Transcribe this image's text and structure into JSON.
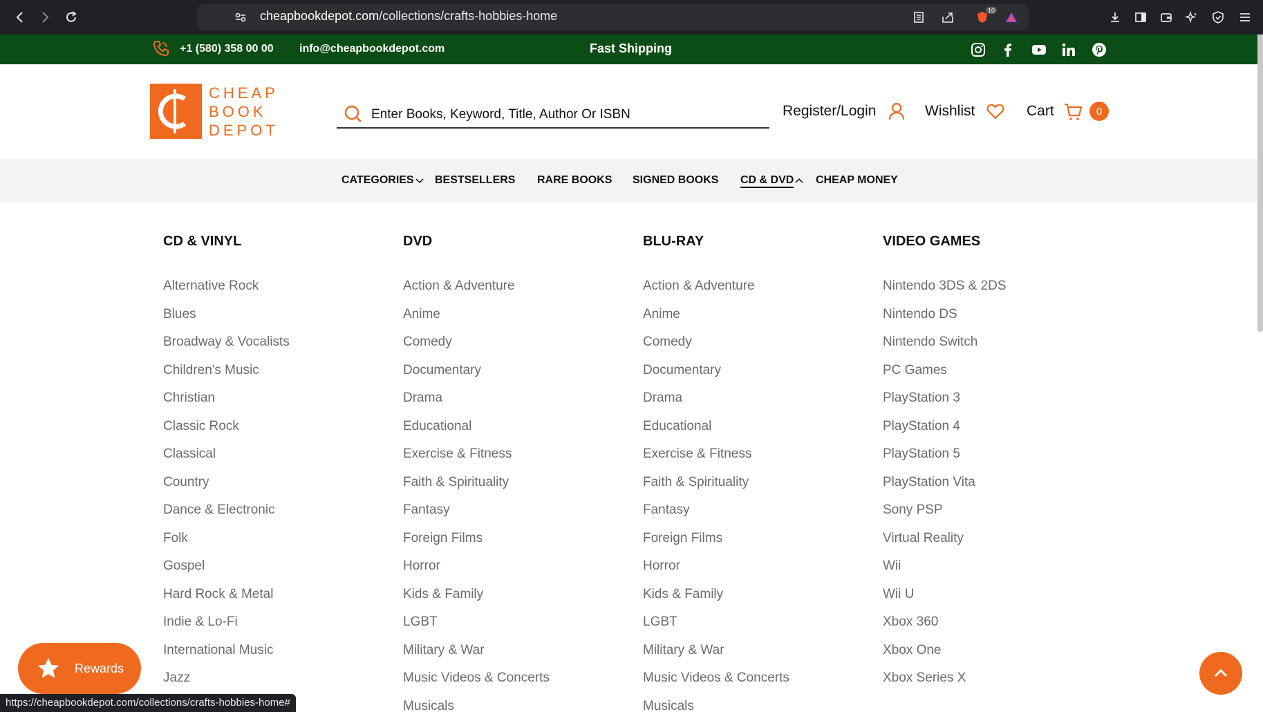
{
  "browser": {
    "url_host": "cheapbookdepot.com",
    "url_path": "/collections/crafts-hobbies-home",
    "status_url": "https://cheapbookdepot.com/collections/crafts-hobbies-home#",
    "extension_badge": "10"
  },
  "topbar": {
    "phone": "+1 (580) 358 00 00",
    "email": "info@cheapbookdepot.com",
    "shipping": "Fast Shipping",
    "socials": [
      "instagram-icon",
      "facebook-icon",
      "youtube-icon",
      "linkedin-icon",
      "pinterest-icon"
    ]
  },
  "header": {
    "logo_lines": [
      "CHEAP",
      "BOOK",
      "DEPOT"
    ],
    "search_placeholder": "Enter Books, Keyword, Title, Author Or ISBN",
    "register": "Register/Login",
    "wishlist": "Wishlist",
    "cart": "Cart",
    "cart_count": "0"
  },
  "nav": {
    "items": [
      "CATEGORIES",
      "BESTSELLERS",
      "RARE BOOKS",
      "SIGNED BOOKS",
      "CD & DVD",
      "CHEAP MONEY"
    ],
    "active": "CD & DVD"
  },
  "mega": {
    "columns": [
      {
        "heading": "CD & VINYL",
        "items": [
          "Alternative Rock",
          "Blues",
          "Broadway & Vocalists",
          "Children's Music",
          "Christian",
          "Classic Rock",
          "Classical",
          "Country",
          "Dance & Electronic",
          "Folk",
          "Gospel",
          "Hard Rock & Metal",
          "Indie & Lo-Fi",
          "International Music",
          "Jazz"
        ]
      },
      {
        "heading": "DVD",
        "items": [
          "Action & Adventure",
          "Anime",
          "Comedy",
          "Documentary",
          "Drama",
          "Educational",
          "Exercise & Fitness",
          "Faith & Spirituality",
          "Fantasy",
          "Foreign Films",
          "Horror",
          "Kids & Family",
          "LGBT",
          "Military & War",
          "Music Videos & Concerts",
          "Musicals"
        ]
      },
      {
        "heading": "BLU-RAY",
        "items": [
          "Action & Adventure",
          "Anime",
          "Comedy",
          "Documentary",
          "Drama",
          "Educational",
          "Exercise & Fitness",
          "Faith & Spirituality",
          "Fantasy",
          "Foreign Films",
          "Horror",
          "Kids & Family",
          "LGBT",
          "Military & War",
          "Music Videos & Concerts",
          "Musicals"
        ]
      },
      {
        "heading": "VIDEO GAMES",
        "items": [
          "Nintendo 3DS & 2DS",
          "Nintendo DS",
          "Nintendo Switch",
          "PC Games",
          "PlayStation 3",
          "PlayStation 4",
          "PlayStation 5",
          "PlayStation Vita",
          "Sony PSP",
          "Virtual Reality",
          "Wii",
          "Wii U",
          "Xbox 360",
          "Xbox One",
          "Xbox Series X"
        ]
      }
    ]
  },
  "floating": {
    "rewards": "Rewards"
  },
  "colors": {
    "brand_orange": "#ef6a1f",
    "topbar_green": "#0b4d16",
    "nav_bg": "#f2f3f5"
  }
}
